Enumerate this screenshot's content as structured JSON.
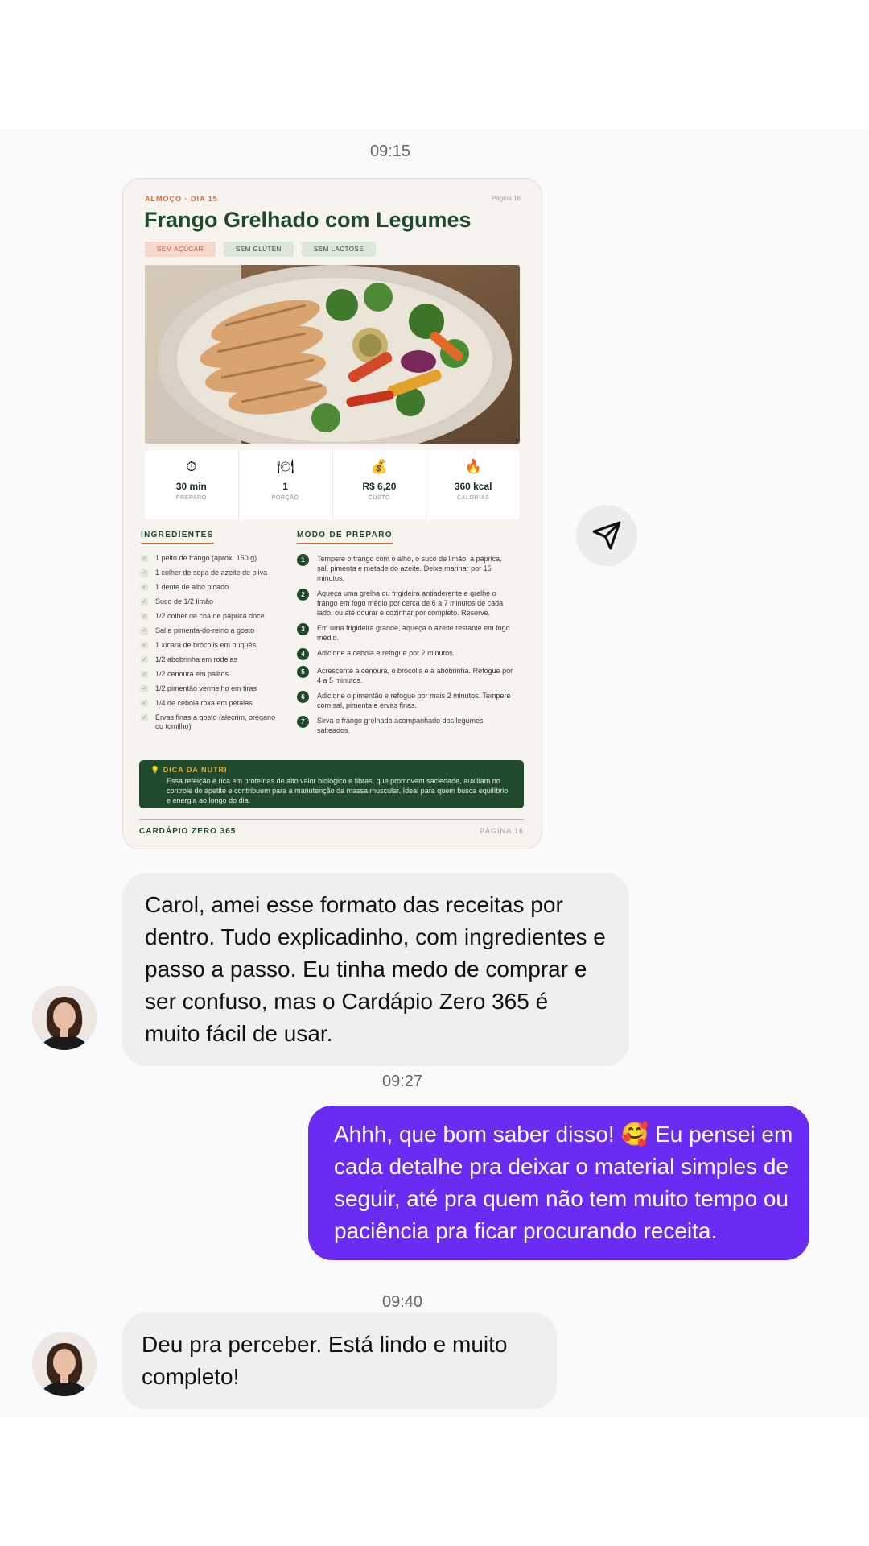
{
  "chat": {
    "time1": "09:15",
    "time2": "09:27",
    "time3": "09:40",
    "msg_in_1": "Carol, amei esse formato das receitas por dentro. Tudo explicadinho, com ingredientes e passo a passo. Eu tinha medo de comprar e ser confuso, mas o Cardápio Zero 365 é muito fácil de usar.",
    "msg_out_1_a": "Ahhh, que bom saber disso! ",
    "msg_out_1_emoji": "🥰",
    "msg_out_1_b": " Eu pensei em cada detalhe pra deixar o material simples de seguir, até pra quem não tem muito tempo ou paciência pra ficar procurando receita.",
    "msg_in_2": "Deu pra perceber. Está lindo e muito completo!"
  },
  "card": {
    "meta": "ALMOÇO · DIA 15",
    "page_top": "Página 16",
    "title": "Frango Grelhado com Legumes",
    "tags": [
      "SEM AÇÚCAR",
      "SEM GLÚTEN",
      "SEM LACTOSE"
    ],
    "stats": [
      {
        "icon": "⏱",
        "value": "30 min",
        "label": "PREPARO"
      },
      {
        "icon": "🍽",
        "value": "1",
        "label": "PORÇÃO"
      },
      {
        "icon": "💰",
        "value": "R$ 6,20",
        "label": "CUSTO"
      },
      {
        "icon": "🔥",
        "value": "360 kcal",
        "label": "CALORIAS"
      }
    ],
    "ingredients_title": "INGREDIENTES",
    "ingredients": [
      "1 peito de frango (aprox. 150 g)",
      "1 colher de sopa de azeite de oliva",
      "1 dente de alho picado",
      "Suco de 1/2 limão",
      "1/2 colher de chá de páprica doce",
      "Sal e pimenta-do-reino a gosto",
      "1 xícara de brócolis em buquês",
      "1/2 abobrinha em rodelas",
      "1/2 cenoura em palitos",
      "1/2 pimentão vermelho em tiras",
      "1/4 de cebola roxa em pétalas",
      "Ervas finas a gosto (alecrim, orégano ou tomilho)"
    ],
    "method_title": "MODO DE PREPARO",
    "steps": [
      "Tempere o frango com o alho, o suco de limão, a páprica, sal, pimenta e metade do azeite. Deixe marinar por 15 minutos.",
      "Aqueça uma grelha ou frigideira antiaderente e grelhe o frango em fogo médio por cerca de 6 a 7 minutos de cada lado, ou até dourar e cozinhar por completo. Reserve.",
      "Em uma frigideira grande, aqueça o azeite restante em fogo médio.",
      "Adicione a cebola e refogue por 2 minutos.",
      "Acrescente a cenoura, o brócolis e a abobrinha. Refogue por 4 a 5 minutos.",
      "Adicione o pimentão e refogue por mais 2 minutos. Tempere com sal, pimenta e ervas finas.",
      "Sirva o frango grelhado acompanhado dos legumes salteados."
    ],
    "tip_title": "DICA DA NUTRI",
    "tip_text": "Essa refeição é rica em proteínas de alto valor biológico e fibras, que promovem saciedade, auxiliam no controle do apetite e contribuem para a manutenção da massa muscular. Ideal para quem busca equilíbrio e energia ao longo do dia.",
    "footer_left": "CARDÁPIO ZERO 365",
    "footer_right": "PÁGINA 16"
  }
}
